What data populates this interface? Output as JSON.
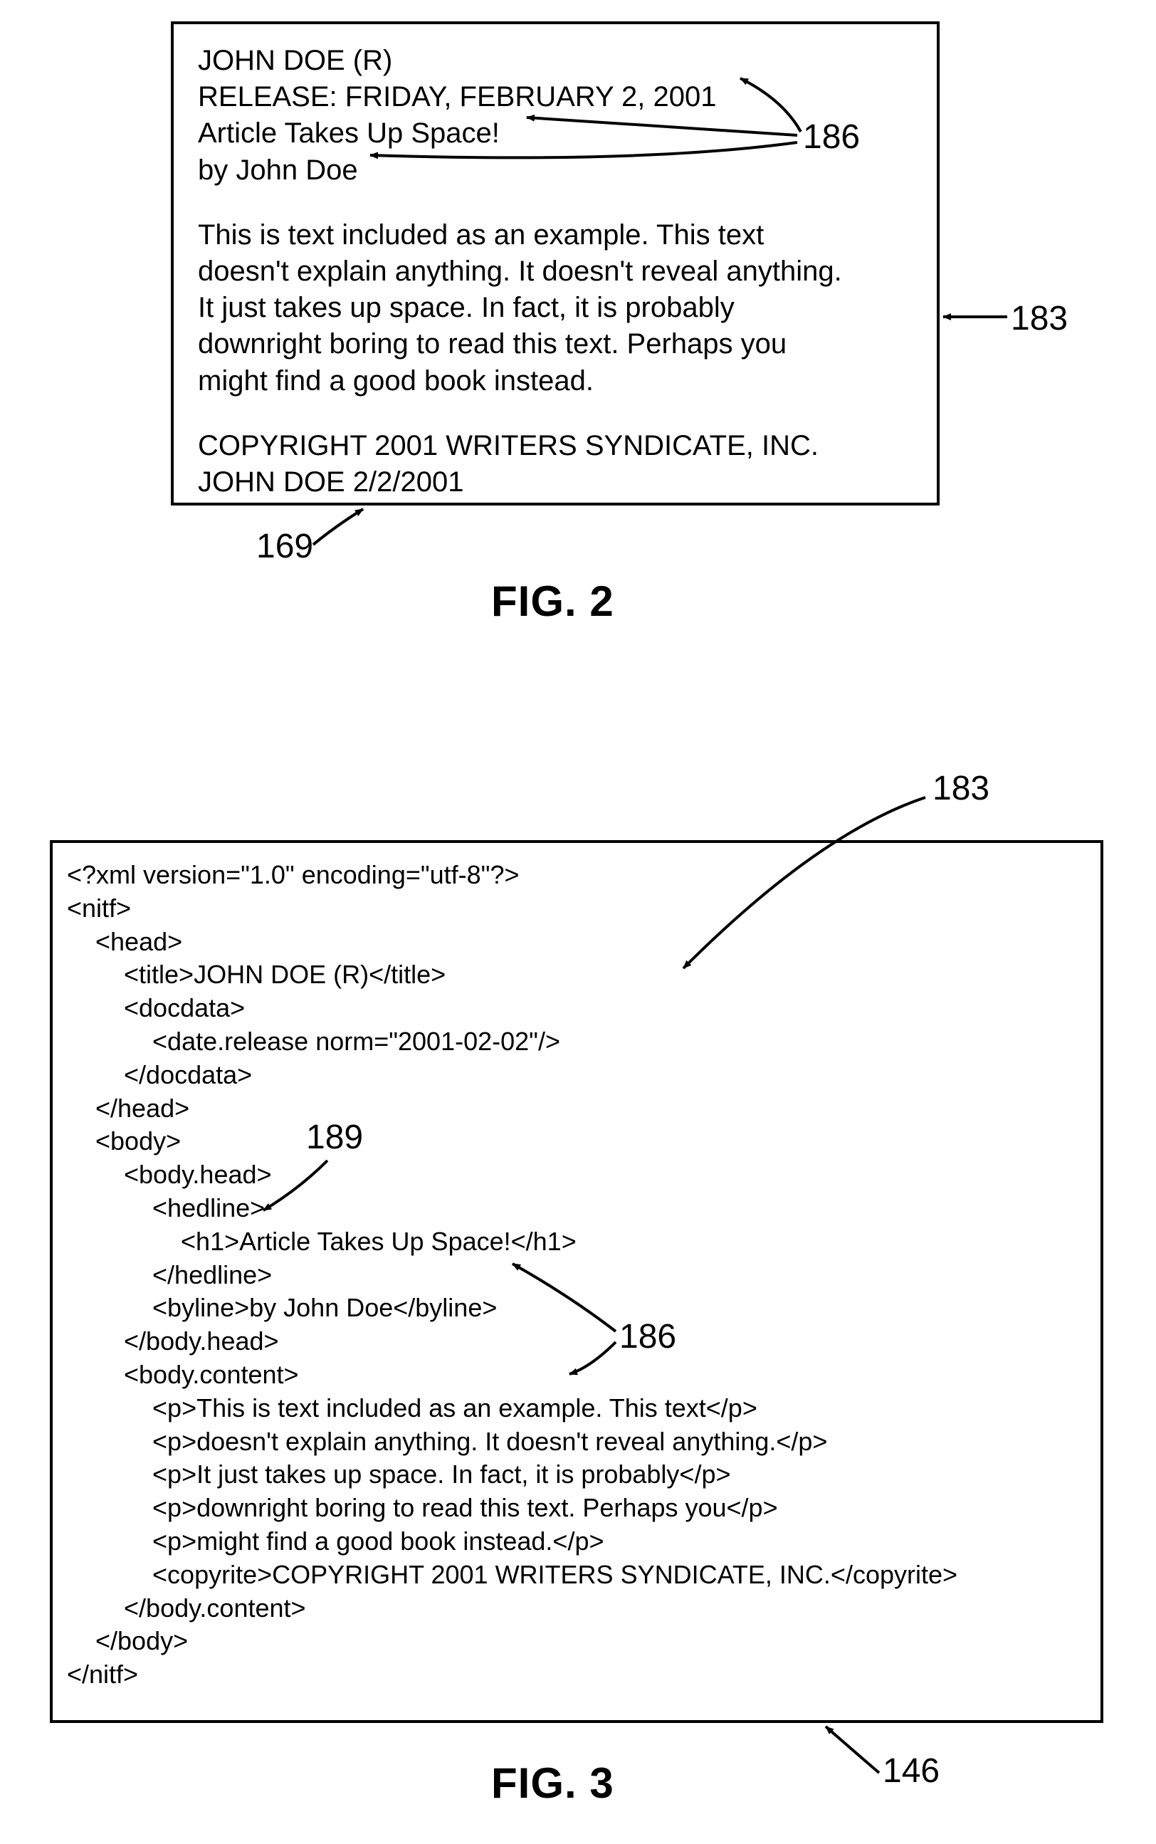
{
  "fig2": {
    "title_line": "JOHN DOE (R)",
    "release_line": "RELEASE: FRIDAY, FEBRUARY 2, 2001",
    "headline": "Article Takes Up Space!",
    "byline": "by John Doe",
    "body_lines": [
      "This is text included as an example.  This text",
      "doesn't explain anything.  It doesn't reveal anything.",
      "It just takes up space.  In fact, it is probably",
      "downright boring to read this text.  Perhaps you",
      "might find a good book instead."
    ],
    "copyright_line": "COPYRIGHT 2001 WRITERS SYNDICATE, INC.",
    "footer_line": "JOHN DOE 2/2/2001",
    "caption": "FIG. 2",
    "ref_186": "186",
    "ref_183": "183",
    "ref_169": "169"
  },
  "fig3": {
    "xml_lines": [
      "<?xml version=\"1.0\" encoding=\"utf-8\"?>",
      "<nitf>",
      "    <head>",
      "        <title>JOHN DOE (R)</title>",
      "        <docdata>",
      "            <date.release norm=\"2001-02-02\"/>",
      "        </docdata>",
      "    </head>",
      "    <body>",
      "        <body.head>",
      "            <hedline>",
      "                <h1>Article Takes Up Space!</h1>",
      "            </hedline>",
      "            <byline>by John Doe</byline>",
      "        </body.head>",
      "        <body.content>",
      "            <p>This is text included as an example. This text</p>",
      "            <p>doesn't explain anything. It doesn't reveal anything.</p>",
      "            <p>It just takes up space. In fact, it is probably</p>",
      "            <p>downright boring to read this text. Perhaps you</p>",
      "            <p>might find a good book instead.</p>",
      "            <copyrite>COPYRIGHT 2001 WRITERS SYNDICATE, INC.</copyrite>",
      "        </body.content>",
      "    </body>",
      "</nitf>"
    ],
    "caption": "FIG. 3",
    "ref_183": "183",
    "ref_189": "189",
    "ref_186": "186",
    "ref_146": "146"
  }
}
